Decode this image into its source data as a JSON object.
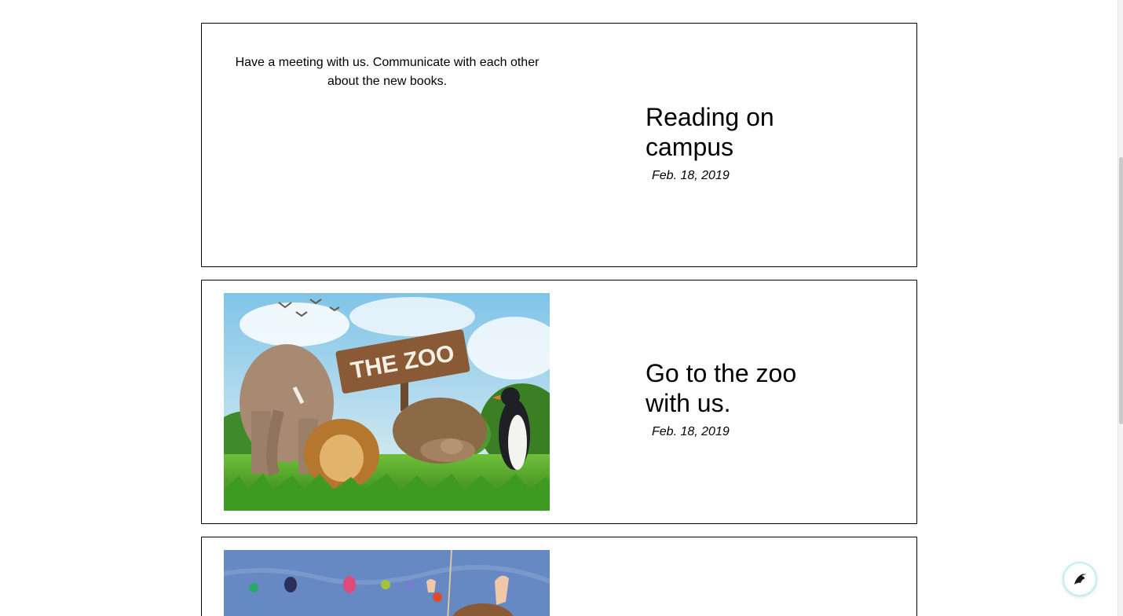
{
  "events": [
    {
      "description": "Have a meeting with us. Communicate with each other about the new books.",
      "title": "Reading on campus",
      "date": "Feb. 18, 2019"
    },
    {
      "image_sign_text": "THE ZOO",
      "title": "Go to the zoo with us.",
      "date": "Feb. 18, 2019"
    },
    {
      "image": "climbing-wall-photo"
    }
  ],
  "chat_button": {
    "icon": "bird-icon"
  },
  "colors": {
    "border": "#000000",
    "fab_ring": "#bdf0f6"
  }
}
